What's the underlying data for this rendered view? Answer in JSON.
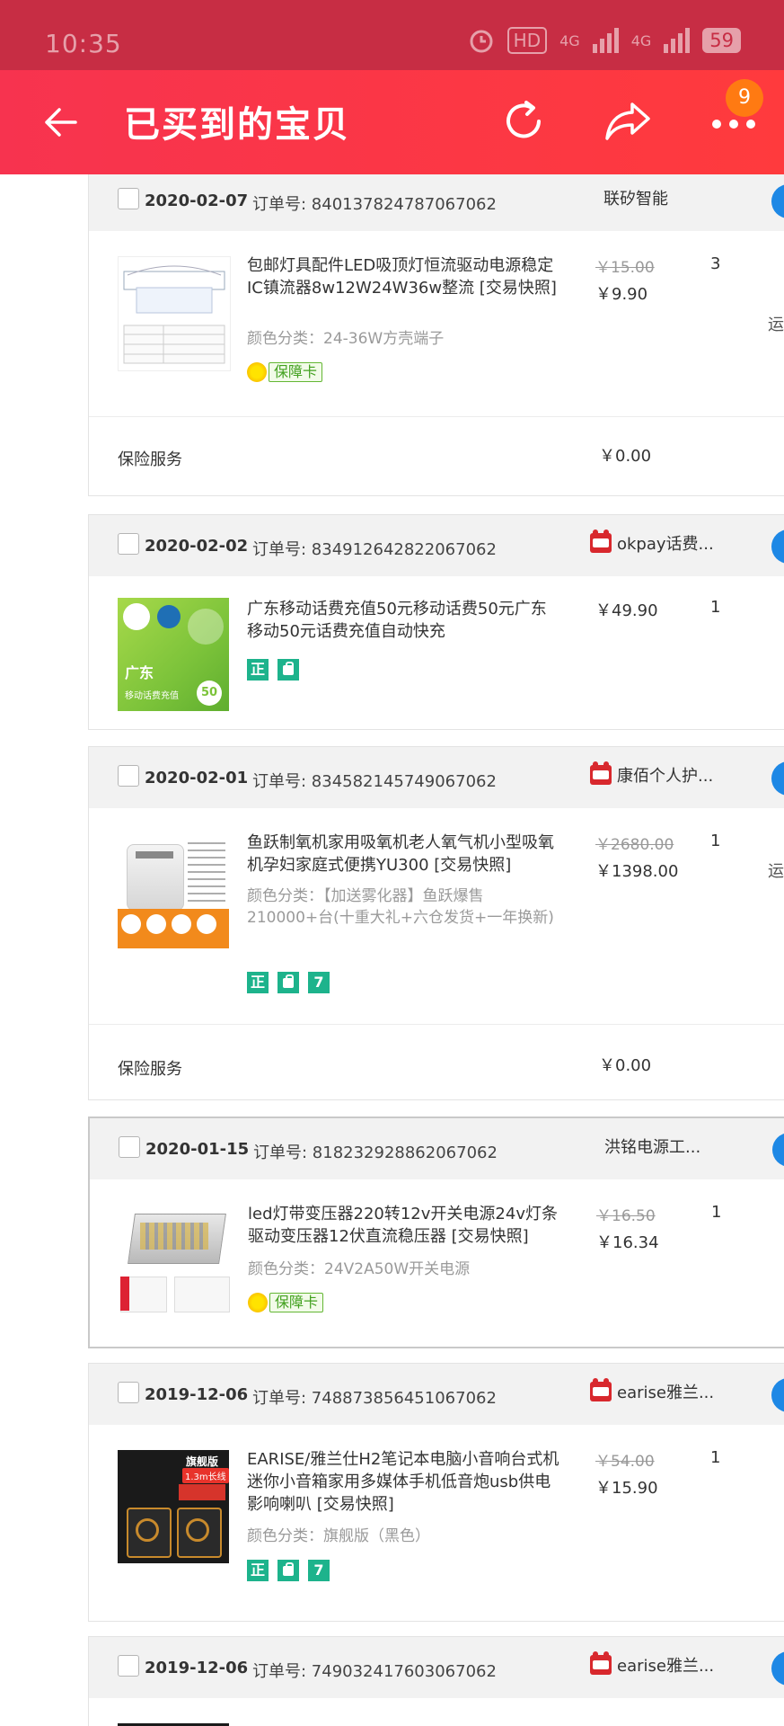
{
  "status_bar": {
    "time": "10:35",
    "hd": "HD",
    "net1": "4G",
    "net2": "4G",
    "battery": "59",
    "icons": [
      "alarm-icon",
      "signal-icon",
      "battery-icon"
    ]
  },
  "header": {
    "title": "已买到的宝贝",
    "badge_count": "9",
    "icons": [
      "back-arrow-icon",
      "refresh-icon",
      "share-icon",
      "more-icon"
    ]
  },
  "colors": {
    "status_bar": "#c72d44",
    "header": "#ff3a3d",
    "badge": "#ff7a12",
    "tag_green": "#1db38c",
    "tmall": "#d8282d"
  },
  "orders": [
    {
      "date": "2020-02-07",
      "order_no": "订单号: 840137824787067062",
      "shop": "联矽智能",
      "tmall": false,
      "title": "包邮灯具配件LED吸顶灯恒流驱动电源稳定IC镇流器8w12W24W36w整流 [交易快照]",
      "variant": "颜色分类：24-36W方壳端子",
      "price_old": "￥15.00",
      "price": "￥9.90",
      "qty": "3",
      "side": "运",
      "tags": [
        "保障卡"
      ],
      "service_label": "保险服务",
      "service_price": "￥0.00"
    },
    {
      "date": "2020-02-02",
      "order_no": "订单号: 834912642822067062",
      "shop": "okpay话费...",
      "tmall": true,
      "title": "广东移动话费充值50元移动话费50元广东移动50元话费充值自动快充",
      "thumb_text": [
        "广东",
        "移动话费充值",
        "50"
      ],
      "price": "￥49.90",
      "qty": "1",
      "tags": [
        "正",
        "bag"
      ]
    },
    {
      "date": "2020-02-01",
      "order_no": "订单号: 834582145749067062",
      "shop": "康佰个人护...",
      "tmall": true,
      "title": "鱼跃制氧机家用吸氧机老人氧气机小型吸氧机孕妇家庭式便携YU300 [交易快照]",
      "variant": "颜色分类：【加送雾化器】鱼跃爆售210000+台(十重大礼+六仓发货+一年换新)",
      "price_old": "￥2680.00",
      "price": "￥1398.00",
      "qty": "1",
      "side": "运",
      "tags": [
        "正",
        "bag",
        "7"
      ],
      "service_label": "保险服务",
      "service_price": "￥0.00"
    },
    {
      "date": "2020-01-15",
      "order_no": "订单号: 818232928862067062",
      "shop": "洪铭电源工...",
      "tmall": false,
      "title": "led灯带变压器220转12v开关电源24v灯条驱动变压器12伏直流稳压器 [交易快照]",
      "variant": "颜色分类：24V2A50W开关电源",
      "price_old": "￥16.50",
      "price": "￥16.34",
      "qty": "1",
      "tags": [
        "保障卡"
      ]
    },
    {
      "date": "2019-12-06",
      "order_no": "订单号: 748873856451067062",
      "shop": "earise雅兰...",
      "tmall": true,
      "title": "EARISE/雅兰仕H2笔记本电脑小音响台式机迷你小音箱家用多媒体手机低音炮usb供电影响喇叭 [交易快照]",
      "variant": "颜色分类：旗舰版（黑色）",
      "thumb_text": [
        "旗舰版",
        "1.3m长线"
      ],
      "price_old": "￥54.00",
      "price": "￥15.90",
      "qty": "1",
      "tags": [
        "正",
        "bag",
        "7"
      ]
    },
    {
      "date": "2019-12-06",
      "order_no": "订单号: 749032417603067062",
      "shop": "earise雅兰...",
      "tmall": true
    }
  ]
}
